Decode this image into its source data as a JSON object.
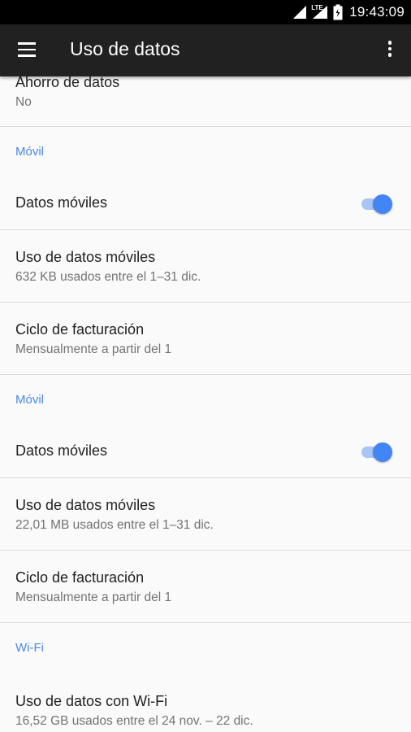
{
  "status_bar": {
    "network": "LTE",
    "time": "19:43:09"
  },
  "app_bar": {
    "title": "Uso de datos"
  },
  "colors": {
    "accent": "#4285f4",
    "category_text": "#4a87e8",
    "app_bar": "#212121"
  },
  "data_saver": {
    "title": "Ahorro de datos",
    "summary": "No"
  },
  "sim1": {
    "category": "Móvil",
    "mobile_data": {
      "title": "Datos móviles",
      "enabled": true
    },
    "usage": {
      "title": "Uso de datos móviles",
      "summary": "632 KB usados entre el 1–31 dic."
    },
    "billing": {
      "title": "Ciclo de facturación",
      "summary": "Mensualmente a partir del 1"
    }
  },
  "sim2": {
    "category": "Móvil",
    "mobile_data": {
      "title": "Datos móviles",
      "enabled": true
    },
    "usage": {
      "title": "Uso de datos móviles",
      "summary": "22,01 MB usados entre el 1–31 dic."
    },
    "billing": {
      "title": "Ciclo de facturación",
      "summary": "Mensualmente a partir del 1"
    }
  },
  "wifi": {
    "category": "Wi-Fi",
    "usage": {
      "title": "Uso de datos con Wi-Fi",
      "summary": "16,52 GB usados entre el 24 nov. – 22 dic."
    }
  }
}
